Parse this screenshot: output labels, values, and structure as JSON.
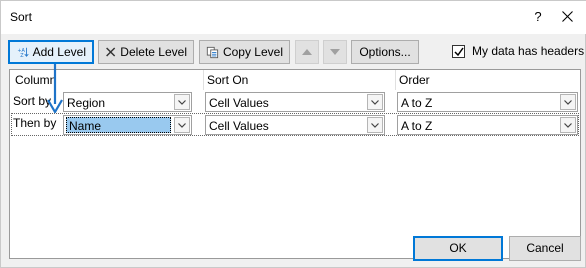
{
  "window": {
    "title": "Sort",
    "help_label": "?"
  },
  "toolbar": {
    "add_level": "Add Level",
    "delete_level": "Delete Level",
    "copy_level": "Copy Level",
    "options": "Options...",
    "headers_checkbox_label": "My data has headers",
    "headers_checked": true
  },
  "grid": {
    "headers": [
      "Column",
      "Sort On",
      "Order"
    ],
    "rows": [
      {
        "label": "Sort by",
        "column": "Region",
        "sort_on": "Cell Values",
        "order": "A to Z"
      },
      {
        "label": "Then by",
        "column": "Name",
        "sort_on": "Cell Values",
        "order": "A to Z"
      }
    ]
  },
  "footer": {
    "ok": "OK",
    "cancel": "Cancel"
  },
  "colors": {
    "accent": "#0078d7",
    "selection": "#99c9ef",
    "callout_arrow": "#1e73c8"
  },
  "icons": {
    "add": "add-level-icon",
    "delete": "delete-x-icon",
    "copy": "copy-icon",
    "up": "move-up-icon",
    "down": "move-down-icon",
    "close": "close-icon",
    "dropdown": "chevron-down-icon"
  }
}
